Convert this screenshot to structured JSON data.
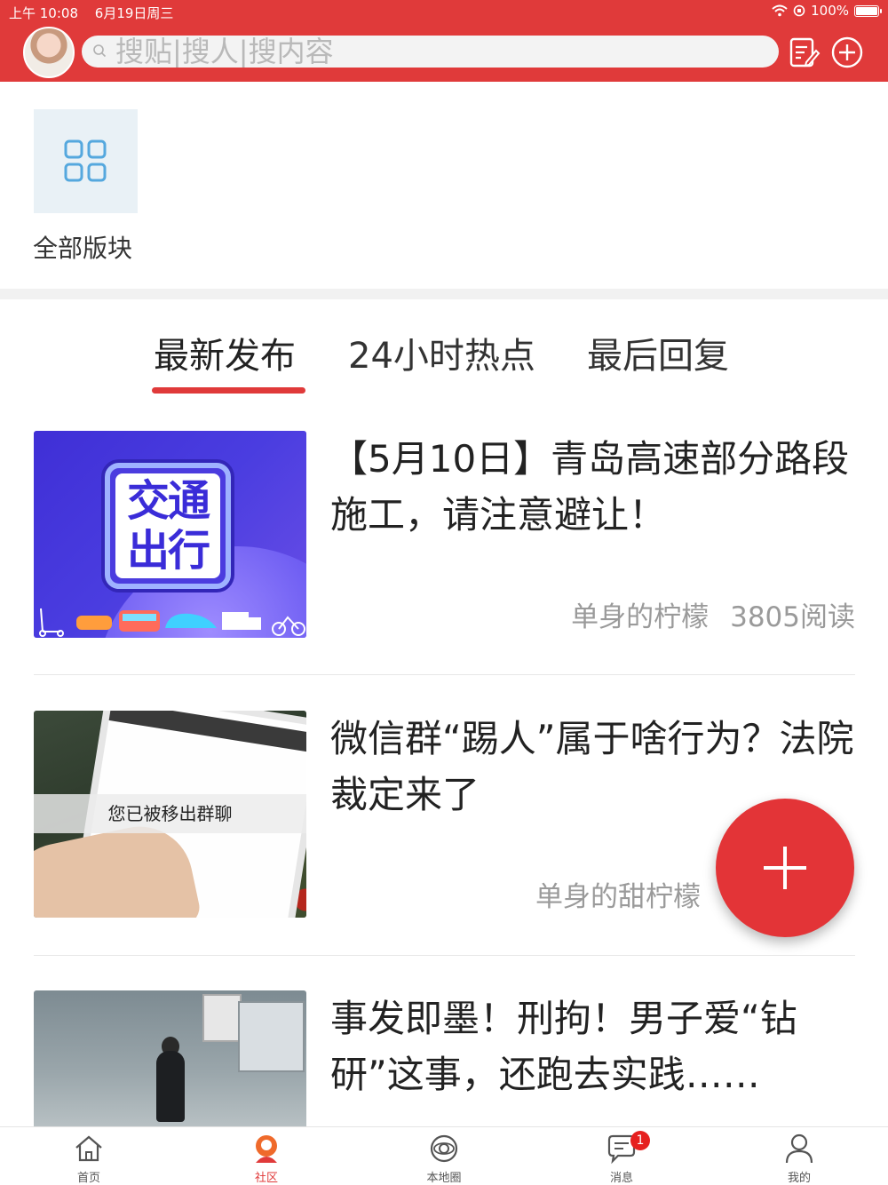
{
  "status_bar": {
    "time": "上午 10:08",
    "date": "6月19日周三",
    "battery": "100%",
    "battery_level": 1.0
  },
  "header": {
    "search_placeholder": "搜贴|搜人|搜内容",
    "icons": [
      "avatar",
      "search-icon",
      "compose-icon",
      "add-circle-icon"
    ]
  },
  "boards": {
    "label": "全部版块",
    "icon": "grid-icon"
  },
  "tabs": [
    {
      "label": "最新发布",
      "active": true
    },
    {
      "label": "24小时热点",
      "active": false
    },
    {
      "label": "最后回复",
      "active": false
    }
  ],
  "articles": [
    {
      "title": "【5月10日】青岛高速部分路段施工，请注意避让！",
      "thumb_text": "交通出行",
      "author": "单身的柠檬",
      "reads": "3805阅读"
    },
    {
      "title": "微信群“踢人”属于啥行为？法院裁定来了",
      "thumb_text": "您已被移出群聊",
      "author": "单身的甜柠檬",
      "reads": ""
    },
    {
      "title": "事发即墨！刑拘！男子爱“钻研”这事，还跑去实践……",
      "thumb_text": "",
      "author": "",
      "reads": ""
    }
  ],
  "fab": {
    "icon": "plus-icon"
  },
  "tabbar": [
    {
      "label": "首页",
      "icon": "home-icon",
      "active": false
    },
    {
      "label": "社区",
      "icon": "community-icon",
      "active": true
    },
    {
      "label": "本地圈",
      "icon": "planet-icon",
      "active": false
    },
    {
      "label": "消息",
      "icon": "message-icon",
      "active": false,
      "badge": "1"
    },
    {
      "label": "我的",
      "icon": "profile-icon",
      "active": false
    }
  ],
  "colors": {
    "brand_red": "#e03a3a",
    "tab_underline": "#e03a3a",
    "badge_red": "#e6201f",
    "tile_bg": "#e9f1f6",
    "tile_icon": "#55a8de"
  }
}
